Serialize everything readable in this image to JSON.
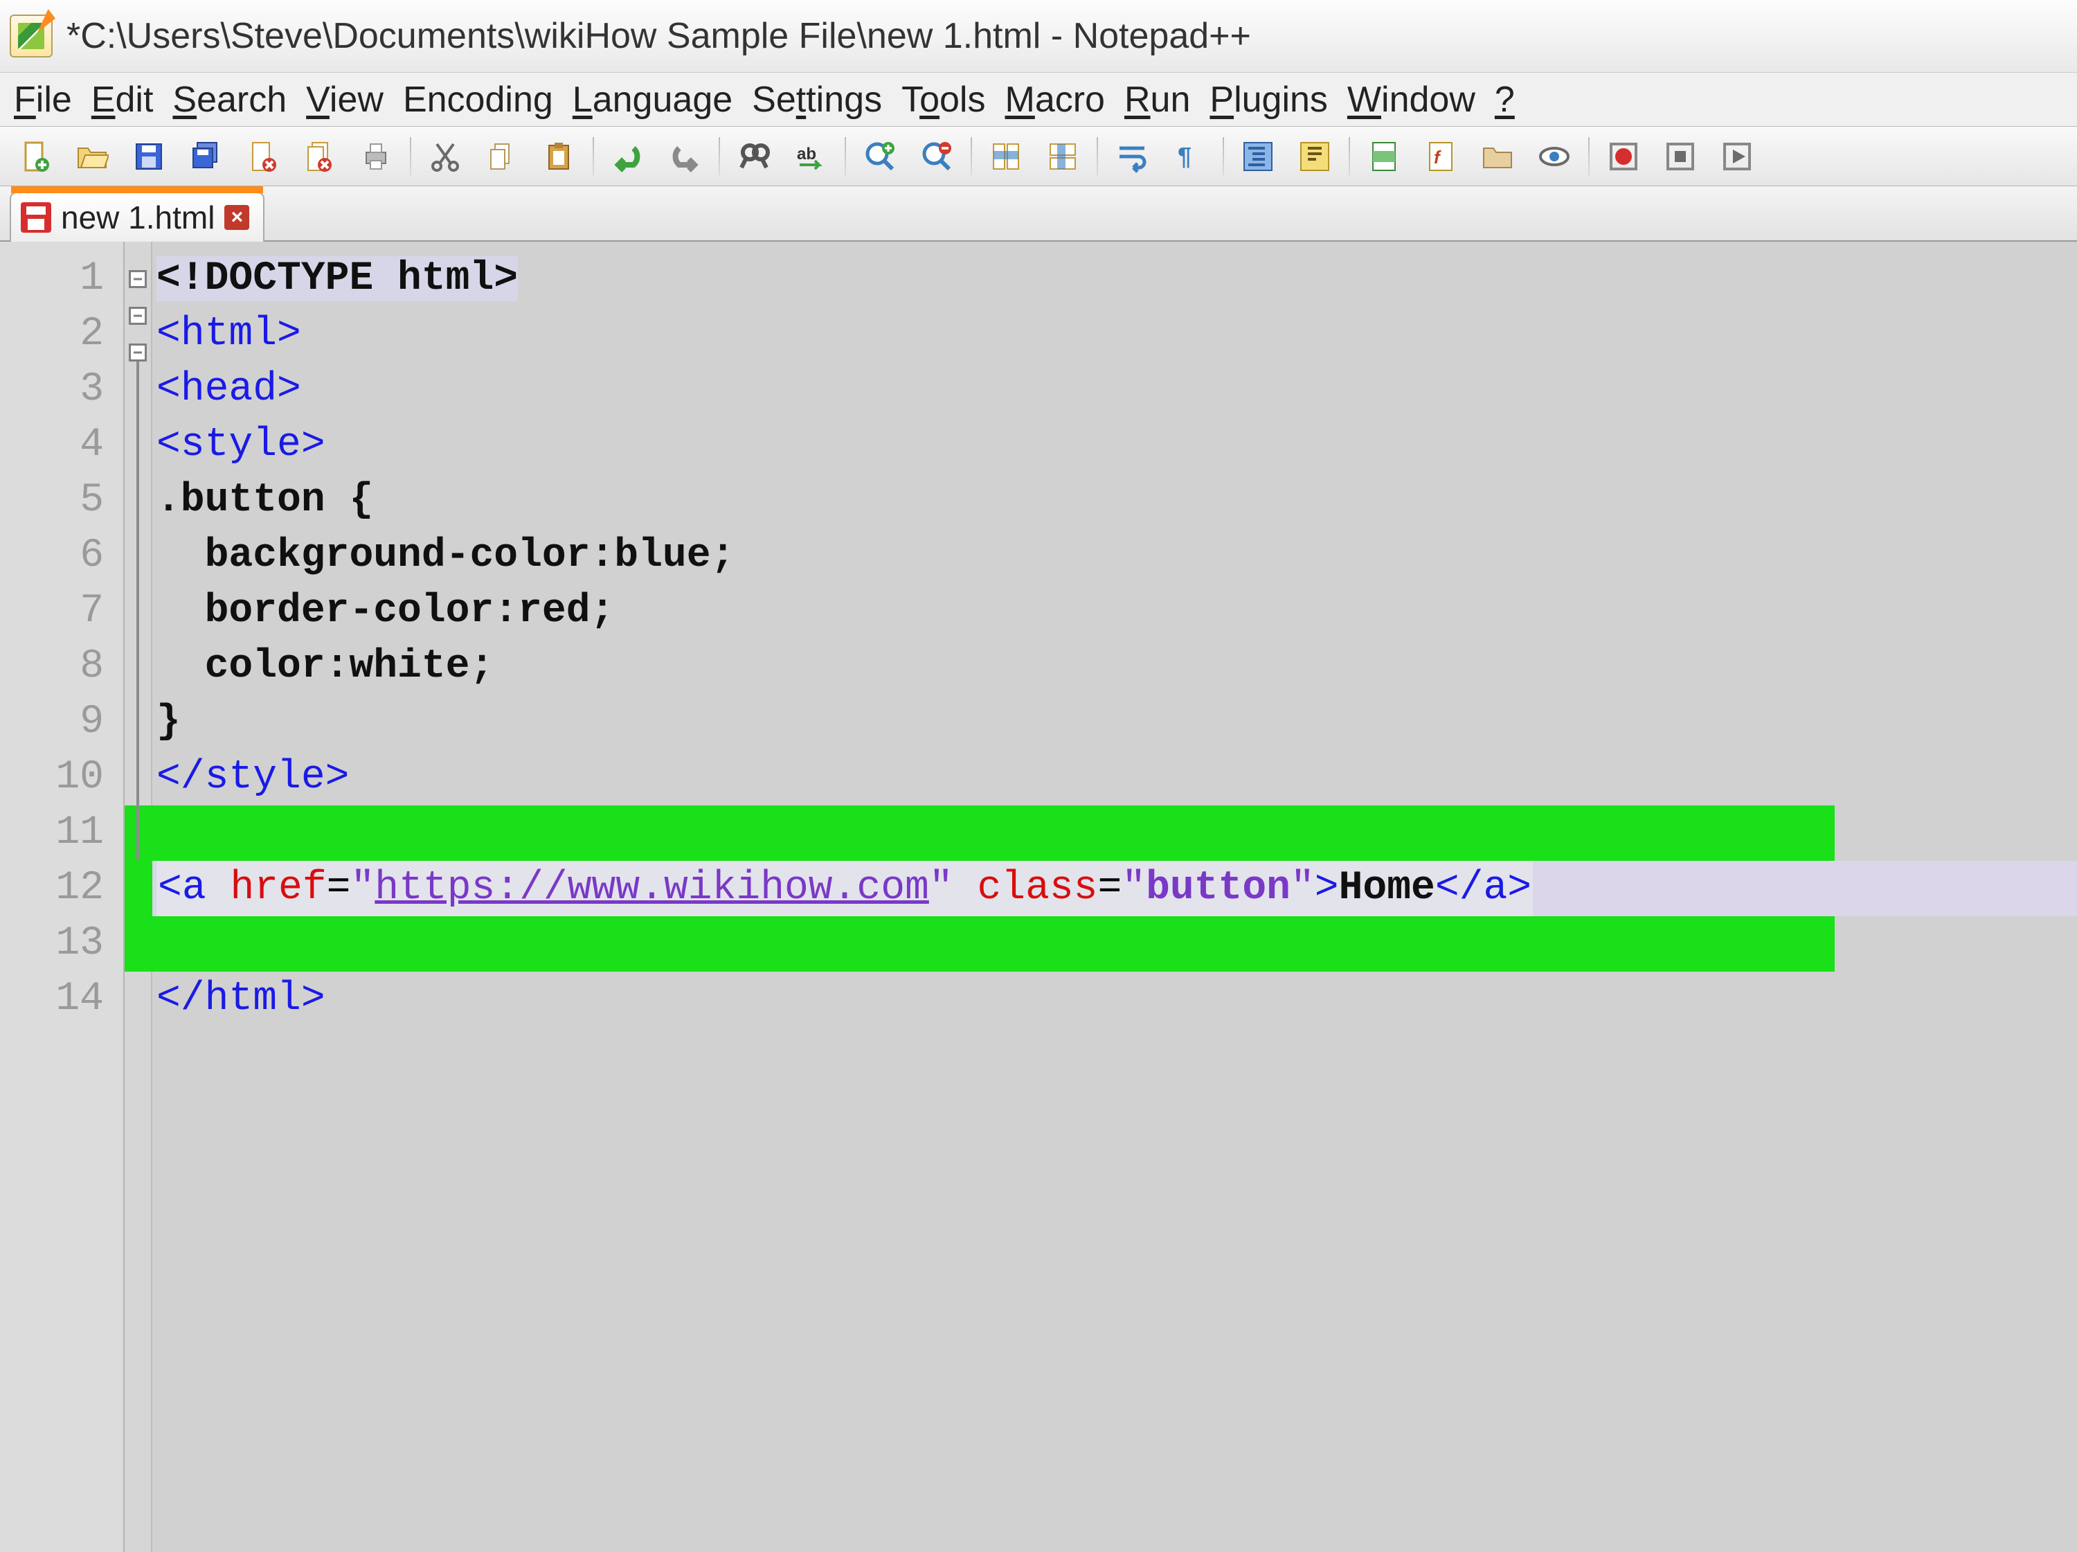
{
  "titlebar": {
    "text": "*C:\\Users\\Steve\\Documents\\wikiHow Sample File\\new 1.html - Notepad++"
  },
  "menu": {
    "file": {
      "pre": "",
      "ul": "F",
      "post": "ile"
    },
    "edit": {
      "pre": "",
      "ul": "E",
      "post": "dit"
    },
    "search": {
      "pre": "",
      "ul": "S",
      "post": "earch"
    },
    "view": {
      "pre": "",
      "ul": "V",
      "post": "iew"
    },
    "encoding": {
      "pre": "Encodin",
      "ul": "g",
      "post": ""
    },
    "language": {
      "pre": "",
      "ul": "L",
      "post": "anguage"
    },
    "settings": {
      "pre": "Se",
      "ul": "t",
      "post": "tings"
    },
    "tools": {
      "pre": "T",
      "ul": "o",
      "post": "ols"
    },
    "macro": {
      "pre": "",
      "ul": "M",
      "post": "acro"
    },
    "run": {
      "pre": "",
      "ul": "R",
      "post": "un"
    },
    "plugins": {
      "pre": "",
      "ul": "P",
      "post": "lugins"
    },
    "window": {
      "pre": "",
      "ul": "W",
      "post": "indow"
    },
    "help": {
      "pre": "",
      "ul": "?",
      "post": ""
    }
  },
  "toolbar": {
    "new": "New",
    "open": "Open",
    "save": "Save",
    "saveall": "Save All",
    "close": "Close",
    "closeall": "Close All",
    "print": "Print",
    "cut": "Cut",
    "copy": "Copy",
    "paste": "Paste",
    "undo": "Undo",
    "redo": "Redo",
    "find": "Find",
    "replace": "Replace",
    "zoomin": "Zoom In",
    "zoomout": "Zoom Out",
    "sync_v": "Sync V Scroll",
    "sync_h": "Sync H Scroll",
    "wordwrap": "Word Wrap",
    "allchars": "Show All Chars",
    "indent": "Indent Guide",
    "lang": "User Lang",
    "docmap": "Doc Map",
    "funclist": "Function List",
    "folder": "Folder",
    "monitor": "Monitor",
    "record": "Record",
    "stop": "Stop",
    "play": "Play"
  },
  "tab": {
    "label": "new 1.html",
    "close": "×"
  },
  "code": {
    "line1": {
      "doctype": "<!DOCTYPE html>"
    },
    "line2": {
      "lt": "<",
      "tag": "html",
      "gt": ">"
    },
    "line3": {
      "lt": "<",
      "tag": "head",
      "gt": ">"
    },
    "line4": {
      "lt": "<",
      "tag": "style",
      "gt": ">"
    },
    "line5": {
      "text": ".button {"
    },
    "line6": {
      "text": "  background-color:blue;"
    },
    "line7": {
      "text": "  border-color:red;"
    },
    "line8": {
      "text": "  color:white;"
    },
    "line9": {
      "text": "}"
    },
    "line10": {
      "lt": "</",
      "tag": "style",
      "gt": ">"
    },
    "line11": {
      "text": ""
    },
    "line12": {
      "a_open_lt": "<",
      "a_tag": "a",
      "sp1": " ",
      "href_attr": "href",
      "eq1": "=",
      "q1a": "\"",
      "href_val": "https://www.wikihow.com",
      "q1b": "\"",
      "sp2": " ",
      "class_attr": "class",
      "eq2": "=",
      "q2a": "\"",
      "class_val": "button",
      "q2b": "\"",
      "a_open_gt": ">",
      "text": "Home",
      "a_close": "</",
      "a_tag2": "a",
      "a_close_gt": ">"
    },
    "line13": {
      "text": ""
    },
    "line14": {
      "lt": "</",
      "tag": "html",
      "gt": ">"
    }
  },
  "gutter": [
    "1",
    "2",
    "3",
    "4",
    "5",
    "6",
    "7",
    "8",
    "9",
    "10",
    "11",
    "12",
    "13",
    "14"
  ]
}
